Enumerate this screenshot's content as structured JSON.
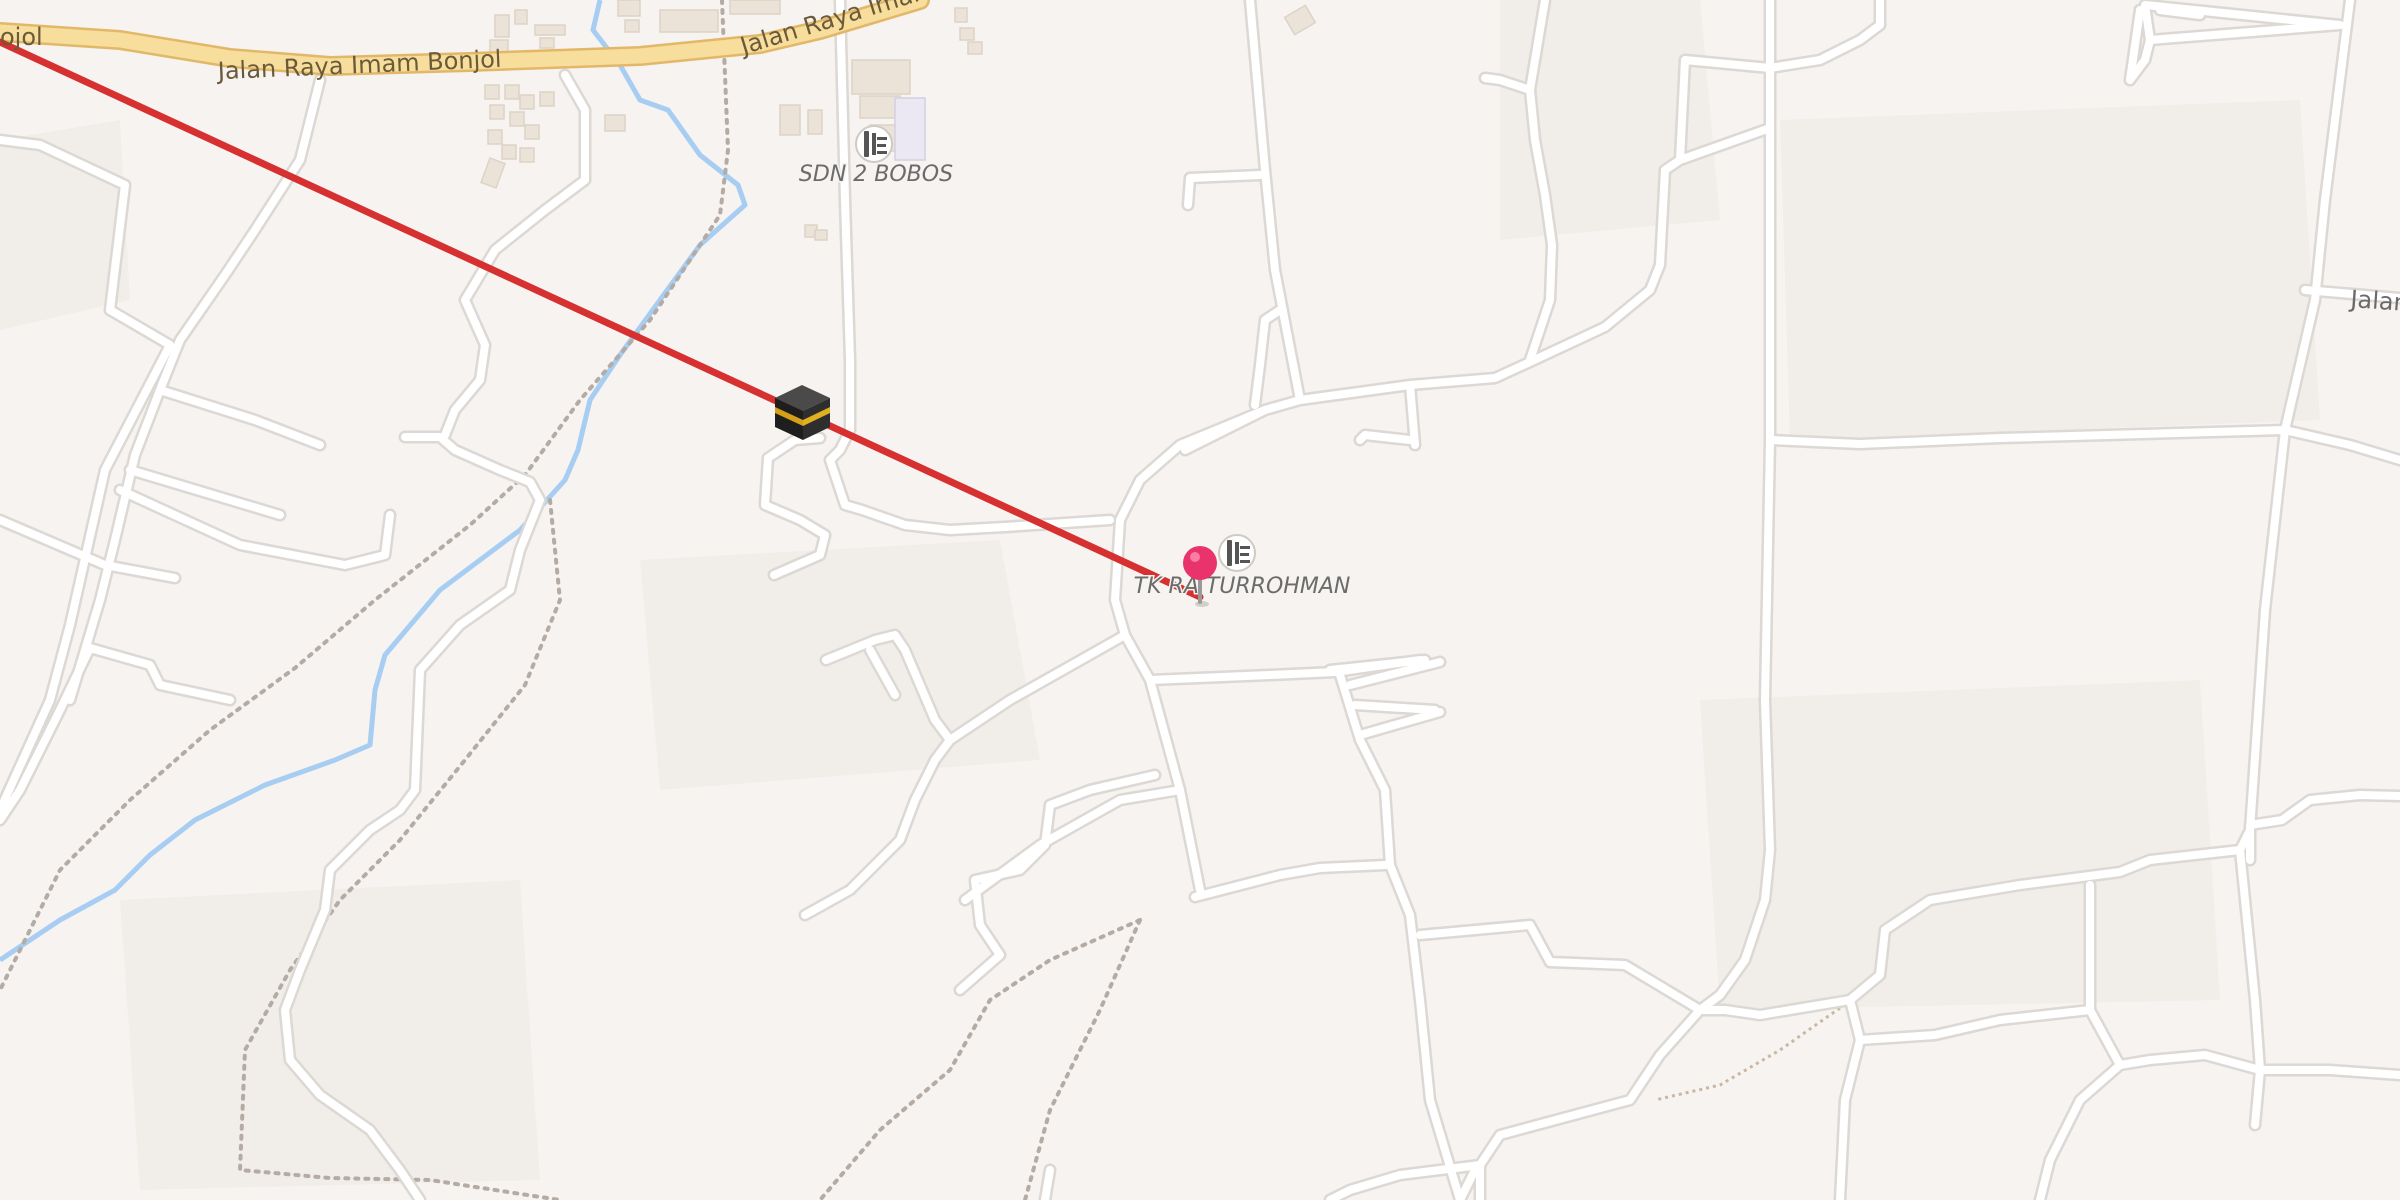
{
  "map": {
    "road_labels": {
      "main_left": "Jalan Raya Imam Bonjol",
      "main_right": "Jalan Raya Imam",
      "edge_left": "ojol",
      "edge_right": "Jalan"
    },
    "poi": {
      "school_1": "SDN 2 BOBOS",
      "school_2": "TK RA TURROHMAN"
    },
    "icons": {
      "school": "school-icon",
      "kaaba": "kaaba-icon",
      "pin": "location-pin-icon"
    },
    "colors": {
      "background": "#f6f3f0",
      "road": "#ffffff",
      "road_casing": "#dcd8d3",
      "main_road": "#f8de9c",
      "main_road_casing": "#e2b868",
      "water": "#a7cdf2",
      "qibla_line": "#d63031",
      "pin": "#e8336d",
      "building": "#ebe3d8"
    }
  }
}
